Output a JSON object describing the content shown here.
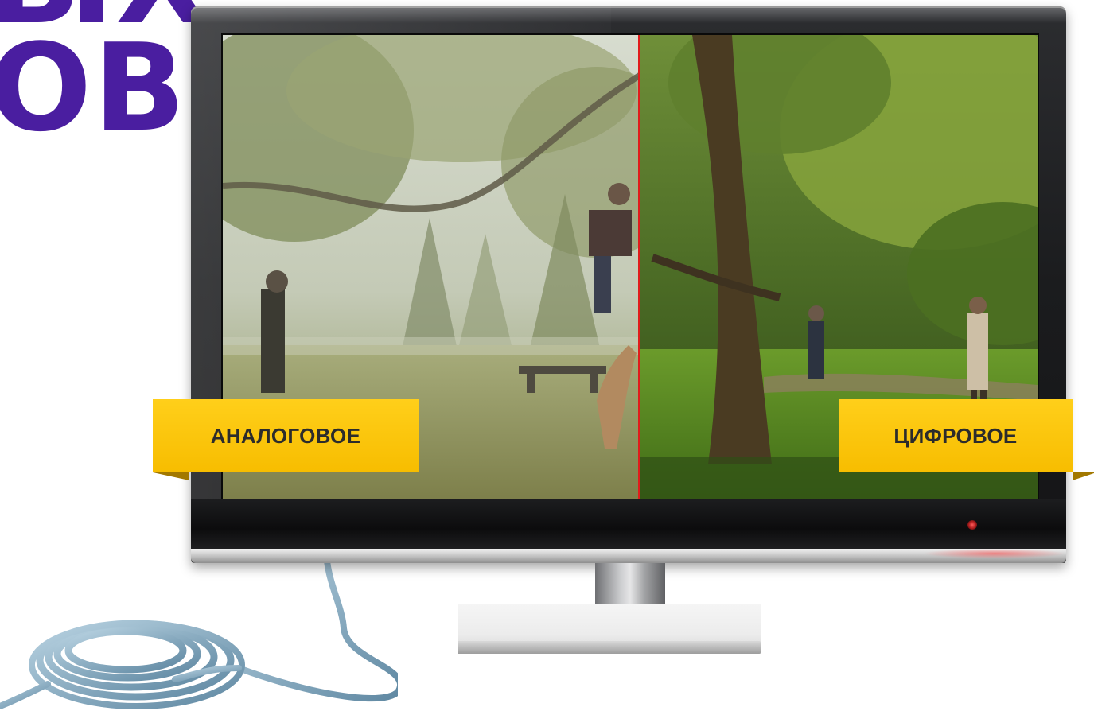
{
  "headline": {
    "line1": "ЫХ",
    "line2": "ОВ"
  },
  "screen": {
    "left_label": "АНАЛОГОВОЕ",
    "right_label": "ЦИФРОВОЕ",
    "divider_color": "#e11b1b"
  },
  "colors": {
    "headline": "#4a1ea0",
    "label_background": "#f7bd00",
    "label_text": "#2c2c2c",
    "power_led": "#ff5a5a"
  },
  "icons": {
    "power_led": "power-led-icon",
    "cable": "coiled-cable-icon"
  }
}
